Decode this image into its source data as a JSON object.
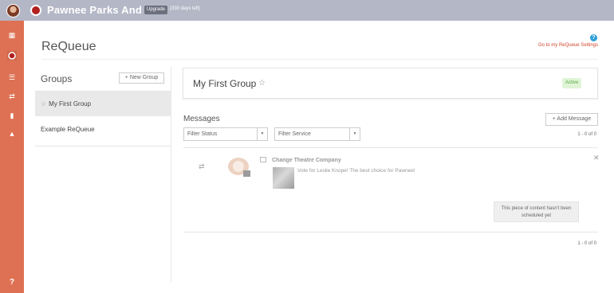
{
  "topbar": {
    "account_name": "Pawnee Parks And Rec",
    "upgrade_label": "Upgrade",
    "days_left": "(330 days left)"
  },
  "sidebar": {
    "icons": [
      "calendar-icon",
      "record-icon",
      "list-icon",
      "shuffle-icon",
      "bar-chart-icon",
      "warning-icon",
      "help-icon"
    ],
    "help_label": "?"
  },
  "page": {
    "title": "ReQueue",
    "settings_link": "Go to my ReQueue Settings",
    "help_glyph": "?"
  },
  "groups": {
    "heading": "Groups",
    "new_group_label": "+ New Group",
    "items": [
      {
        "label": "My First Group",
        "starred": true,
        "selected": true
      },
      {
        "label": "Example ReQueue",
        "starred": false,
        "selected": false
      }
    ]
  },
  "group_detail": {
    "title": "My First Group",
    "status_badge": "Active"
  },
  "messages": {
    "heading": "Messages",
    "add_label": "+ Add Message",
    "filter_status_label": "Filter Status",
    "filter_service_label": "Filter Service",
    "count_top": "1 - 0 of 0",
    "count_bottom": "1 - 0 of 0",
    "items": [
      {
        "source": "Change Theatre Company",
        "text": "Vote for Leslie Knope! The best choice for Pawnee!",
        "tooltip": "This piece of content hasn't been scheduled yet"
      }
    ]
  },
  "colors": {
    "topbar": "#b4b7c6",
    "sidebar": "#de7153",
    "link": "#d0452b",
    "active_badge_bg": "#dff5d6"
  }
}
